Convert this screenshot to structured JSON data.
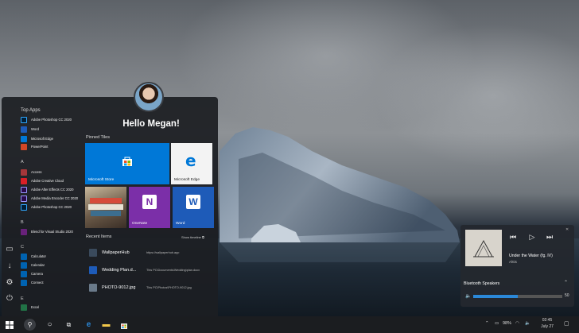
{
  "start": {
    "greeting": "Hello Megan!",
    "top_apps_header": "Top Apps",
    "top_apps": [
      "Adobe Photoshop CC 2020",
      "Word",
      "Microsoft Edge",
      "PowerPoint"
    ],
    "groups": [
      {
        "letter": "A",
        "apps": [
          "Access",
          "Adobe Creative Cloud",
          "Adobe After Effects CC 2020",
          "Adobe Media Encoder CC 2020",
          "Adobe Photoshop CC 2020"
        ]
      },
      {
        "letter": "B",
        "apps": [
          "Blend for Visual Studio 2020"
        ]
      },
      {
        "letter": "C",
        "apps": [
          "Calculator",
          "Calendar",
          "Camera",
          "Connect"
        ]
      },
      {
        "letter": "E",
        "apps": [
          "Excel"
        ]
      }
    ],
    "pinned_header": "Pinned Tiles",
    "tiles": [
      "Microsoft Store",
      "Microsoft Edge",
      "",
      "OneNote",
      "Word"
    ],
    "recent_header": "Recent Items",
    "show_timeline": "Show timeline",
    "recent": [
      {
        "name": "WallpaperHub",
        "path": "https://wallpaperhub.app"
      },
      {
        "name": "Wedding Plan.d...",
        "path": "This PC\\Documents\\Wedding\\plan.docx"
      },
      {
        "name": "PHOTO-9012.jpg",
        "path": "This PC\\Photos\\PHOTO-9012.jpg"
      }
    ]
  },
  "media": {
    "song": "Under the Water (fg. IV)",
    "artist": "Alttis",
    "device": "Bluetooth Speakers",
    "volume": 50,
    "volume_label": "50"
  },
  "tray": {
    "battery": "98%",
    "time": "02:45",
    "date": "July 27"
  },
  "colors": {
    "accent": "#0078d7",
    "onenote": "#7b2fa8",
    "word": "#1e5bb8"
  }
}
